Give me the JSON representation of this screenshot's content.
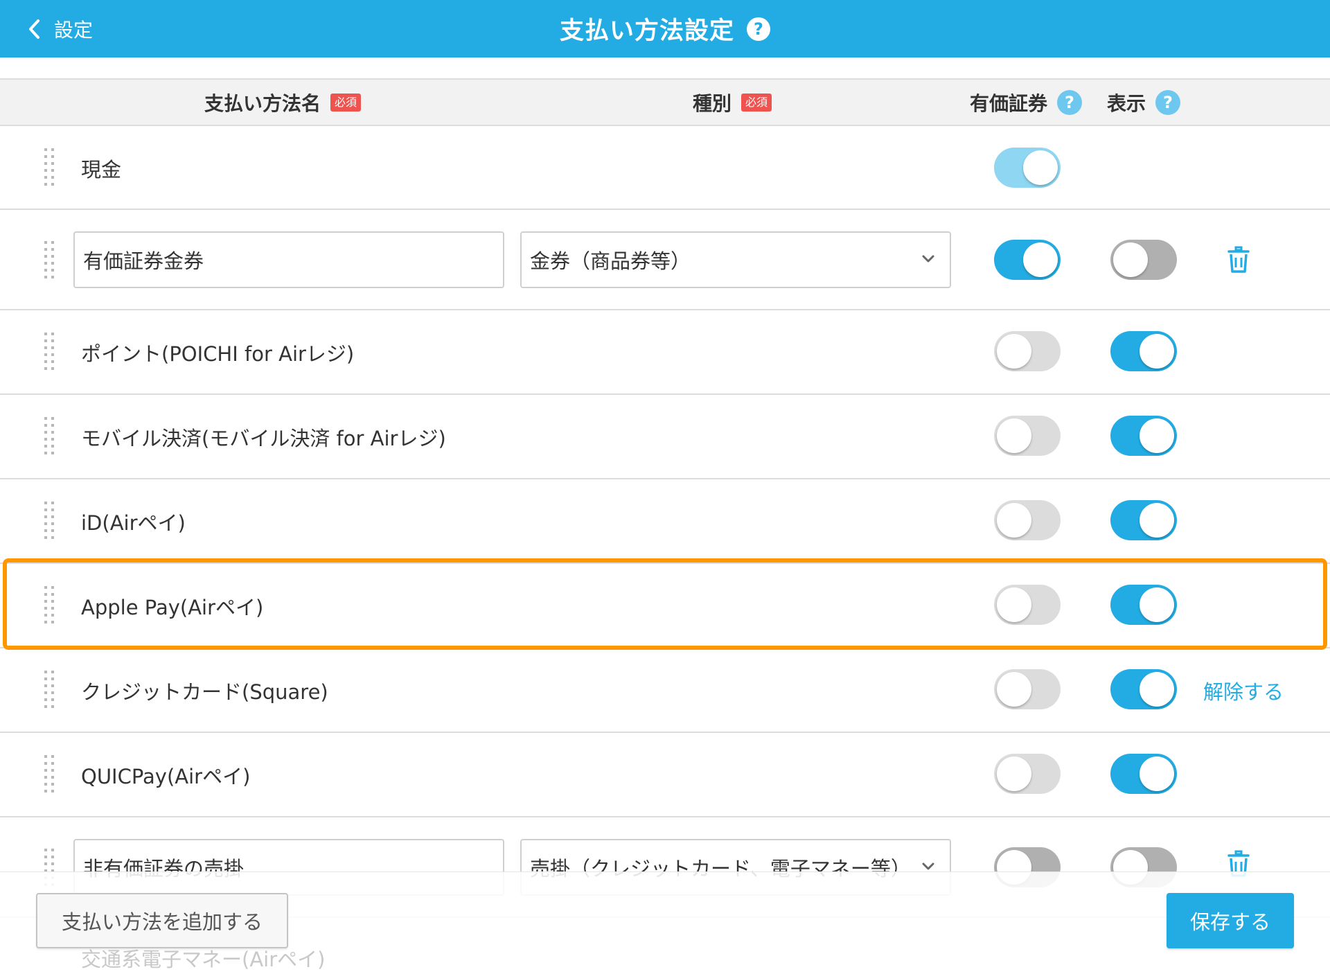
{
  "header": {
    "back_label": "設定",
    "title": "支払い方法設定",
    "help_glyph": "?"
  },
  "columns": {
    "name": "支払い方法名",
    "name_required": "必須",
    "type": "種別",
    "type_required": "必須",
    "securities": "有価証券",
    "display": "表示",
    "help_glyph": "?"
  },
  "rows": [
    {
      "label": "現金",
      "securities": true,
      "display": null
    },
    {
      "input_value": "有価証券金券",
      "select_value": "金券（商品券等）",
      "securities": true,
      "display": false,
      "action": "trash"
    },
    {
      "label": "ポイント(POICHI for Airレジ)",
      "securities": false,
      "display": true
    },
    {
      "label": "モバイル決済(モバイル決済 for Airレジ)",
      "securities": false,
      "display": true
    },
    {
      "label": "iD(Airペイ)",
      "securities": false,
      "display": true
    },
    {
      "label": "Apple Pay(Airペイ)",
      "securities": false,
      "display": true,
      "highlighted": true
    },
    {
      "label": "クレジットカード(Square)",
      "securities": false,
      "display": true,
      "action_label": "解除する"
    },
    {
      "label": "QUICPay(Airペイ)",
      "securities": false,
      "display": true
    },
    {
      "input_value": "非有価証券の売掛",
      "select_value": "売掛（クレジットカード、電子マネー等）",
      "securities": false,
      "display": false,
      "action": "trash"
    },
    {
      "label": "交通系電子マネー(Airペイ)",
      "securities": false,
      "display": true
    }
  ],
  "footer": {
    "add_label": "支払い方法を追加する",
    "save_label": "保存する"
  },
  "colors": {
    "accent": "#22ace3",
    "highlight": "#ff9800",
    "required": "#ef5350"
  }
}
